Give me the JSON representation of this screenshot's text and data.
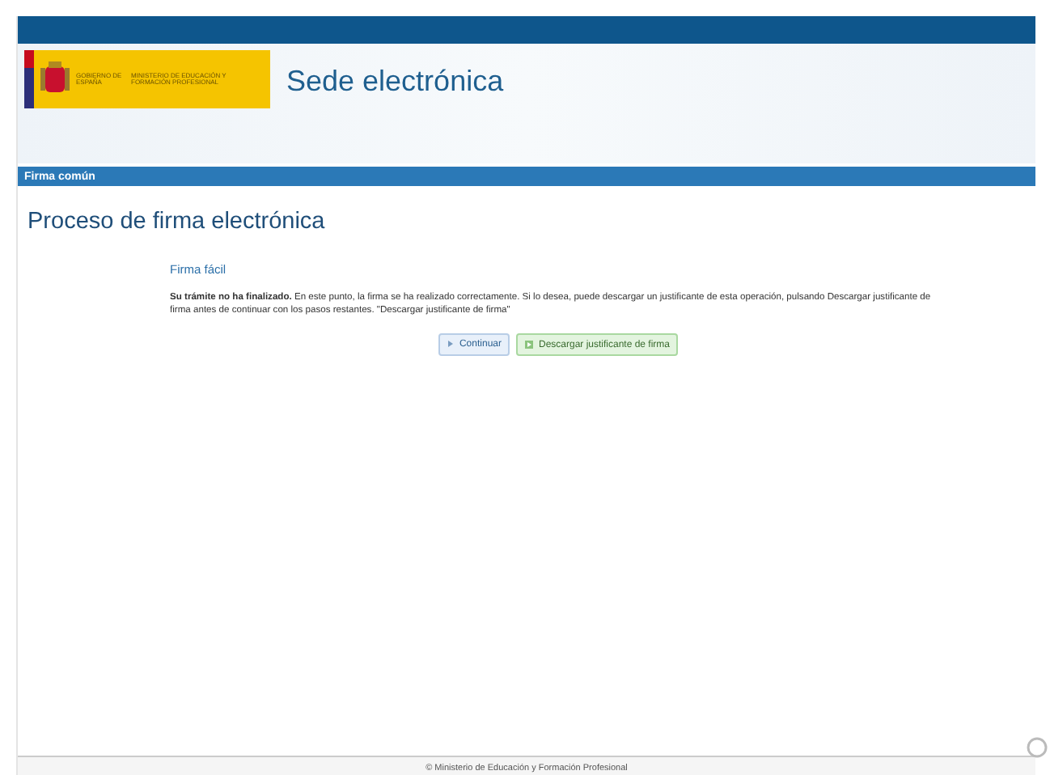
{
  "header": {
    "logo_government": "GOBIERNO DE ESPAÑA",
    "logo_ministry": "MINISTERIO DE EDUCACIÓN Y FORMACIÓN PROFESIONAL",
    "title": "Sede electrónica"
  },
  "section_bar": {
    "label": "Firma común"
  },
  "page_title": "Proceso de firma electrónica",
  "panel": {
    "heading": "Firma fácil",
    "message": "**Su trámite no ha finalizado.** En este punto, la firma se ha realizado correctamente. Si lo desea, puede descargar un justificante de esta operación, pulsando Descargar justificante de firma antes de continuar con los pasos restantes. \"Descargar justificante de firma\"",
    "buttons": [
      {
        "kind": "continue",
        "label": "Continuar"
      },
      {
        "kind": "download",
        "label": "Descargar justificante de firma"
      }
    ]
  },
  "footer": "© Ministerio de Educación y Formación Profesional"
}
